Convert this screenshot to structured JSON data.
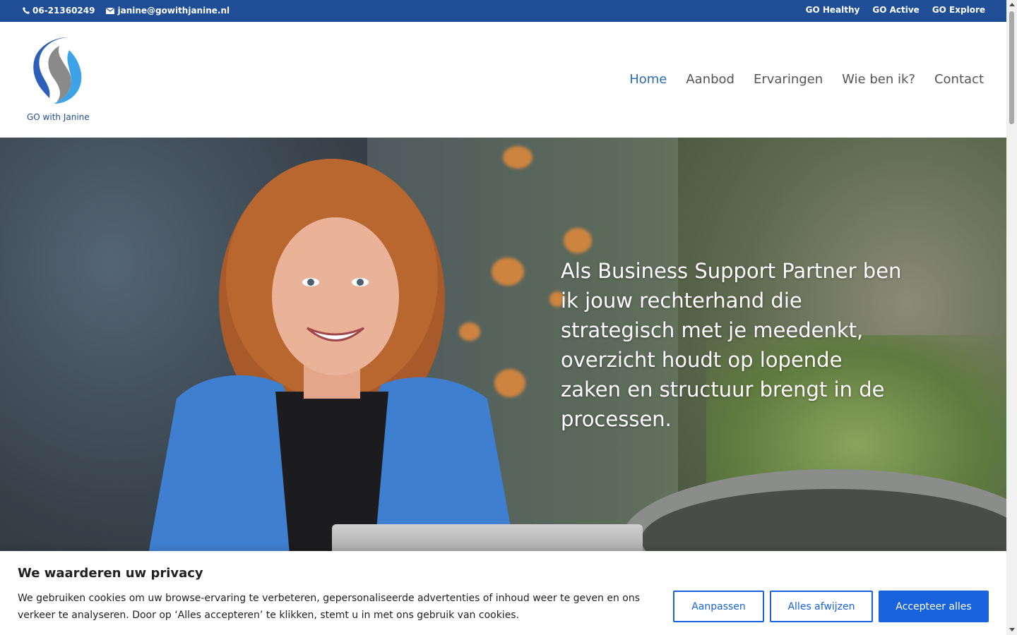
{
  "topbar": {
    "phone": "06-21360249",
    "email": "janine@gowithjanine.nl",
    "links": [
      "GO Healthy",
      "GO Active",
      "GO Explore"
    ]
  },
  "header": {
    "logo_text": "GO with Janine",
    "nav": [
      {
        "label": "Home",
        "active": true
      },
      {
        "label": "Aanbod",
        "active": false
      },
      {
        "label": "Ervaringen",
        "active": false
      },
      {
        "label": "Wie ben ik?",
        "active": false
      },
      {
        "label": "Contact",
        "active": false
      }
    ]
  },
  "hero": {
    "text": "Als Business Support Partner ben ik jouw rechterhand die strategisch met je meedenkt, overzicht houdt op lopende zaken en structuur brengt in de processen."
  },
  "cookie": {
    "title": "We waarderen uw privacy",
    "body": "We gebruiken cookies om uw browse-ervaring te verbeteren, gepersonaliseerde advertenties of inhoud weer te geven en ons verkeer te analyseren. Door op ‘Alles accepteren’ te klikken, stemt u in met ons gebruik van cookies.",
    "customize_label": "Aanpassen",
    "reject_label": "Alles afwijzen",
    "accept_label": "Accepteer alles"
  },
  "colors": {
    "topbar": "#1f4e96",
    "nav_active": "#2e6db4",
    "cookie_accent": "#1863dc"
  }
}
